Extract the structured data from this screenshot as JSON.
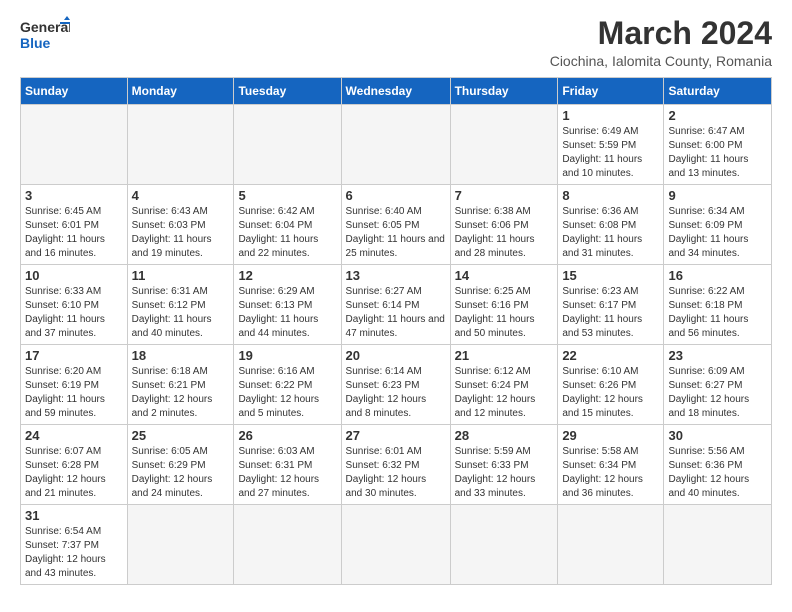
{
  "header": {
    "logo_general": "General",
    "logo_blue": "Blue",
    "month_year": "March 2024",
    "location": "Ciochina, Ialomita County, Romania"
  },
  "days_of_week": [
    "Sunday",
    "Monday",
    "Tuesday",
    "Wednesday",
    "Thursday",
    "Friday",
    "Saturday"
  ],
  "weeks": [
    [
      {
        "day": "",
        "info": ""
      },
      {
        "day": "",
        "info": ""
      },
      {
        "day": "",
        "info": ""
      },
      {
        "day": "",
        "info": ""
      },
      {
        "day": "",
        "info": ""
      },
      {
        "day": "1",
        "info": "Sunrise: 6:49 AM\nSunset: 5:59 PM\nDaylight: 11 hours and 10 minutes."
      },
      {
        "day": "2",
        "info": "Sunrise: 6:47 AM\nSunset: 6:00 PM\nDaylight: 11 hours and 13 minutes."
      }
    ],
    [
      {
        "day": "3",
        "info": "Sunrise: 6:45 AM\nSunset: 6:01 PM\nDaylight: 11 hours and 16 minutes."
      },
      {
        "day": "4",
        "info": "Sunrise: 6:43 AM\nSunset: 6:03 PM\nDaylight: 11 hours and 19 minutes."
      },
      {
        "day": "5",
        "info": "Sunrise: 6:42 AM\nSunset: 6:04 PM\nDaylight: 11 hours and 22 minutes."
      },
      {
        "day": "6",
        "info": "Sunrise: 6:40 AM\nSunset: 6:05 PM\nDaylight: 11 hours and 25 minutes."
      },
      {
        "day": "7",
        "info": "Sunrise: 6:38 AM\nSunset: 6:06 PM\nDaylight: 11 hours and 28 minutes."
      },
      {
        "day": "8",
        "info": "Sunrise: 6:36 AM\nSunset: 6:08 PM\nDaylight: 11 hours and 31 minutes."
      },
      {
        "day": "9",
        "info": "Sunrise: 6:34 AM\nSunset: 6:09 PM\nDaylight: 11 hours and 34 minutes."
      }
    ],
    [
      {
        "day": "10",
        "info": "Sunrise: 6:33 AM\nSunset: 6:10 PM\nDaylight: 11 hours and 37 minutes."
      },
      {
        "day": "11",
        "info": "Sunrise: 6:31 AM\nSunset: 6:12 PM\nDaylight: 11 hours and 40 minutes."
      },
      {
        "day": "12",
        "info": "Sunrise: 6:29 AM\nSunset: 6:13 PM\nDaylight: 11 hours and 44 minutes."
      },
      {
        "day": "13",
        "info": "Sunrise: 6:27 AM\nSunset: 6:14 PM\nDaylight: 11 hours and 47 minutes."
      },
      {
        "day": "14",
        "info": "Sunrise: 6:25 AM\nSunset: 6:16 PM\nDaylight: 11 hours and 50 minutes."
      },
      {
        "day": "15",
        "info": "Sunrise: 6:23 AM\nSunset: 6:17 PM\nDaylight: 11 hours and 53 minutes."
      },
      {
        "day": "16",
        "info": "Sunrise: 6:22 AM\nSunset: 6:18 PM\nDaylight: 11 hours and 56 minutes."
      }
    ],
    [
      {
        "day": "17",
        "info": "Sunrise: 6:20 AM\nSunset: 6:19 PM\nDaylight: 11 hours and 59 minutes."
      },
      {
        "day": "18",
        "info": "Sunrise: 6:18 AM\nSunset: 6:21 PM\nDaylight: 12 hours and 2 minutes."
      },
      {
        "day": "19",
        "info": "Sunrise: 6:16 AM\nSunset: 6:22 PM\nDaylight: 12 hours and 5 minutes."
      },
      {
        "day": "20",
        "info": "Sunrise: 6:14 AM\nSunset: 6:23 PM\nDaylight: 12 hours and 8 minutes."
      },
      {
        "day": "21",
        "info": "Sunrise: 6:12 AM\nSunset: 6:24 PM\nDaylight: 12 hours and 12 minutes."
      },
      {
        "day": "22",
        "info": "Sunrise: 6:10 AM\nSunset: 6:26 PM\nDaylight: 12 hours and 15 minutes."
      },
      {
        "day": "23",
        "info": "Sunrise: 6:09 AM\nSunset: 6:27 PM\nDaylight: 12 hours and 18 minutes."
      }
    ],
    [
      {
        "day": "24",
        "info": "Sunrise: 6:07 AM\nSunset: 6:28 PM\nDaylight: 12 hours and 21 minutes."
      },
      {
        "day": "25",
        "info": "Sunrise: 6:05 AM\nSunset: 6:29 PM\nDaylight: 12 hours and 24 minutes."
      },
      {
        "day": "26",
        "info": "Sunrise: 6:03 AM\nSunset: 6:31 PM\nDaylight: 12 hours and 27 minutes."
      },
      {
        "day": "27",
        "info": "Sunrise: 6:01 AM\nSunset: 6:32 PM\nDaylight: 12 hours and 30 minutes."
      },
      {
        "day": "28",
        "info": "Sunrise: 5:59 AM\nSunset: 6:33 PM\nDaylight: 12 hours and 33 minutes."
      },
      {
        "day": "29",
        "info": "Sunrise: 5:58 AM\nSunset: 6:34 PM\nDaylight: 12 hours and 36 minutes."
      },
      {
        "day": "30",
        "info": "Sunrise: 5:56 AM\nSunset: 6:36 PM\nDaylight: 12 hours and 40 minutes."
      }
    ],
    [
      {
        "day": "31",
        "info": "Sunrise: 6:54 AM\nSunset: 7:37 PM\nDaylight: 12 hours and 43 minutes."
      },
      {
        "day": "",
        "info": ""
      },
      {
        "day": "",
        "info": ""
      },
      {
        "day": "",
        "info": ""
      },
      {
        "day": "",
        "info": ""
      },
      {
        "day": "",
        "info": ""
      },
      {
        "day": "",
        "info": ""
      }
    ]
  ]
}
